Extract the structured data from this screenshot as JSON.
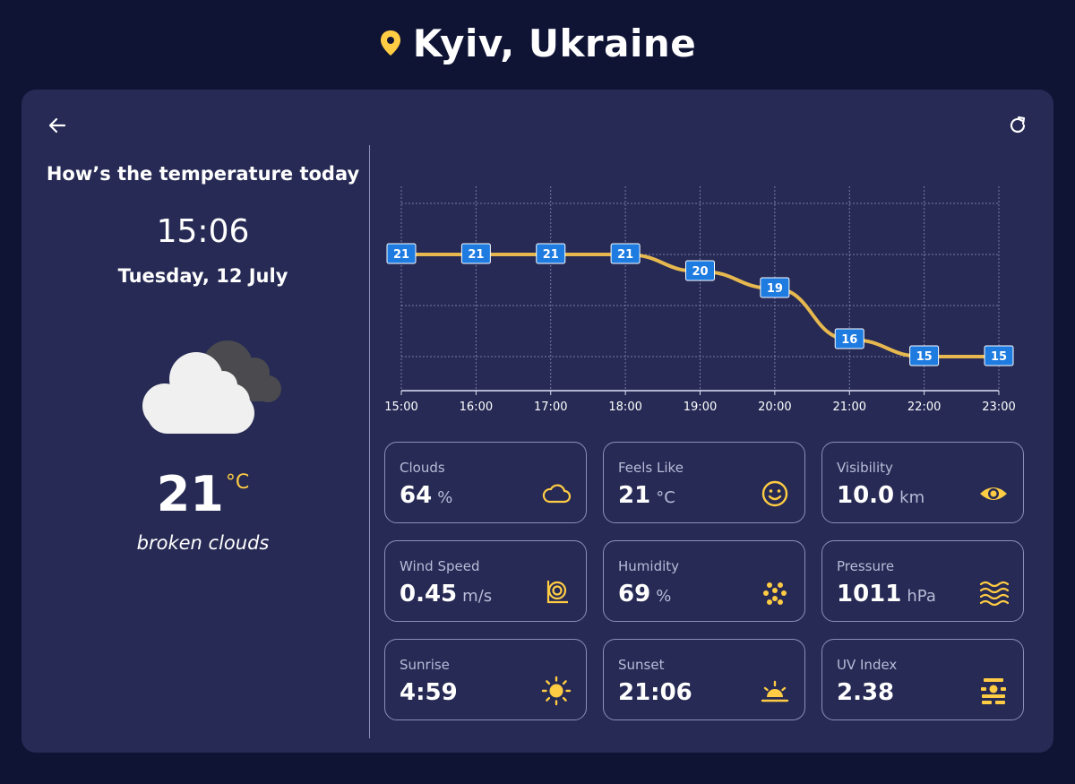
{
  "header": {
    "location": "Kyiv, Ukraine",
    "pin_icon": "location-pin-icon",
    "accent": "#ffcc44"
  },
  "controls": {
    "back_icon": "arrow-left-icon",
    "refresh_icon": "refresh-icon"
  },
  "summary": {
    "question": "How’s the temperature today",
    "time": "15:06",
    "date": "Tuesday, 12 July",
    "weather_icon": "broken-clouds-icon",
    "temperature": "21",
    "temperature_unit": "°C",
    "description": "broken clouds"
  },
  "chart_data": {
    "type": "line",
    "x": [
      "15:00",
      "16:00",
      "17:00",
      "18:00",
      "19:00",
      "20:00",
      "21:00",
      "22:00",
      "23:00"
    ],
    "series": [
      {
        "values": [
          21,
          21,
          21,
          21,
          20,
          19,
          16,
          15,
          15
        ]
      }
    ],
    "ylim": [
      13,
      25
    ],
    "grid": true,
    "line_color": "#e6b84f",
    "label_color": "#1e7be0"
  },
  "details": [
    {
      "label": "Clouds",
      "value": "64",
      "unit": "%",
      "icon": "cloud-icon"
    },
    {
      "label": "Feels Like",
      "value": "21",
      "unit": "°C",
      "icon": "smiley-icon"
    },
    {
      "label": "Visibility",
      "value": "10.0",
      "unit": "km",
      "icon": "eye-icon"
    },
    {
      "label": "Wind Speed",
      "value": "0.45",
      "unit": "m/s",
      "icon": "wind-icon"
    },
    {
      "label": "Humidity",
      "value": "69",
      "unit": "%",
      "icon": "humidity-dots-icon"
    },
    {
      "label": "Pressure",
      "value": "1011",
      "unit": "hPa",
      "icon": "waves-icon"
    },
    {
      "label": "Sunrise",
      "value": "4:59",
      "unit": "",
      "icon": "sun-icon"
    },
    {
      "label": "Sunset",
      "value": "21:06",
      "unit": "",
      "icon": "sunset-icon"
    },
    {
      "label": "UV Index",
      "value": "2.38",
      "unit": "",
      "icon": "uv-index-icon"
    }
  ]
}
